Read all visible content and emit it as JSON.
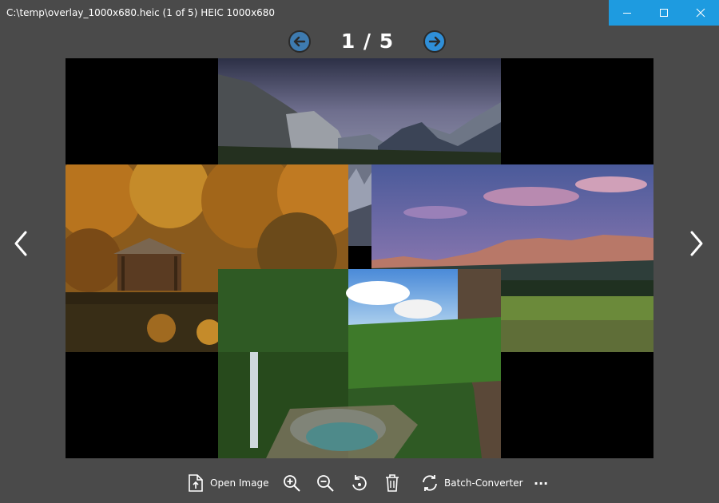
{
  "window": {
    "title": "C:\\temp\\overlay_1000x680.heic (1 of 5) HEIC 1000x680",
    "accent": "#1e9be0",
    "background": "#4a4a4a"
  },
  "pager": {
    "current": "1 / 5",
    "prev_icon": "circle-arrow-left-icon",
    "next_icon": "circle-arrow-right-icon"
  },
  "image": {
    "tiles": [
      "mountain-valley-top",
      "autumn-gazebo-lake",
      "snowy-trees-strip",
      "purple-sky-mountains-meadow",
      "waterfall-pool-canyon"
    ]
  },
  "toolbar": {
    "open_label": "Open Image",
    "batch_label": "Batch-Converter",
    "more_label": "···",
    "icons": [
      "open-file-icon",
      "zoom-in-icon",
      "zoom-out-icon",
      "rotate-icon",
      "delete-icon",
      "sync-icon",
      "more-icon"
    ]
  }
}
